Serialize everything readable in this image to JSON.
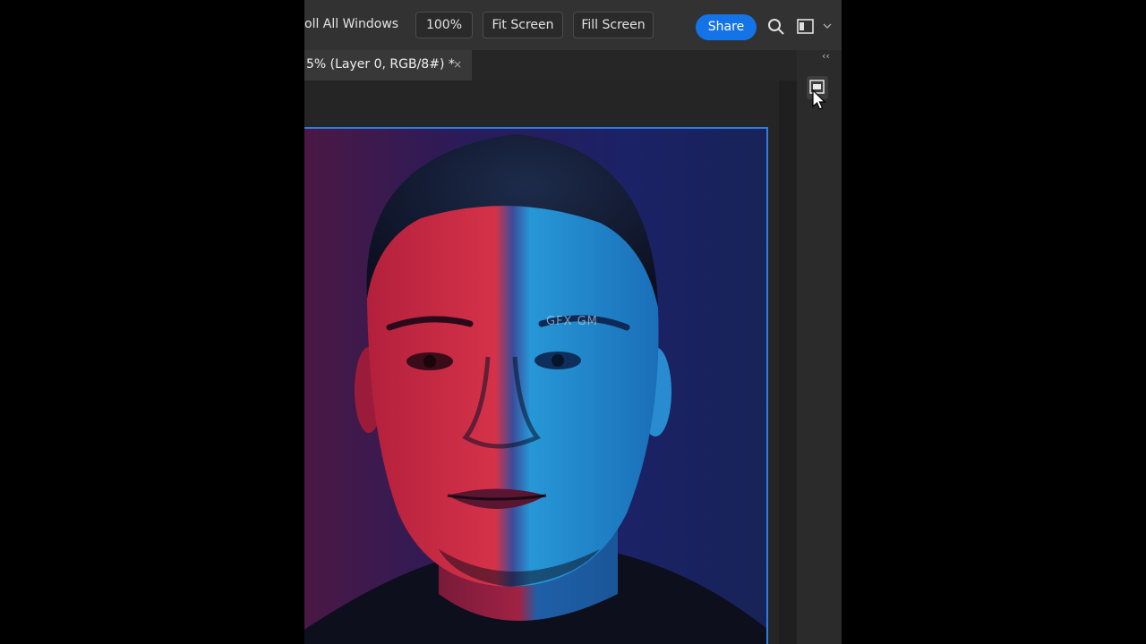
{
  "options_bar": {
    "scroll_all_windows_label": "oll All Windows",
    "zoom_100_label": "100%",
    "fit_screen_label": "Fit Screen",
    "fill_screen_label": "Fill Screen",
    "share_label": "Share",
    "icons": [
      "search-icon",
      "workspace-icon",
      "chevron-down-icon"
    ]
  },
  "document_tab": {
    "title": "5% (Layer 0, RGB/8#) *",
    "close_glyph": "×"
  },
  "canvas": {
    "watermark": "GFX GM",
    "selection_color": "#2d7de6"
  },
  "right_panel": {
    "collapse_glyph": "‹‹",
    "icons": [
      "panel-toggle-icon",
      "pointer-cursor-icon"
    ]
  },
  "colors": {
    "accent": "#1473e6",
    "panel_bg": "#323232",
    "canvas_bg": "#252525"
  }
}
